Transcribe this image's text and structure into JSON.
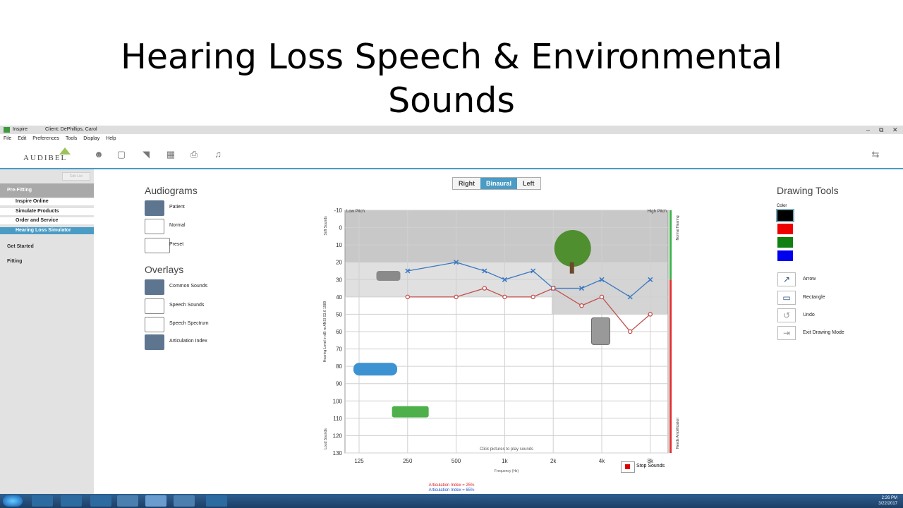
{
  "slide": {
    "title_line1": "Hearing Loss Speech & Environmental",
    "title_line2": "Sounds"
  },
  "window": {
    "app_name": "Inspire",
    "client": "Client: DePhillips, Carol",
    "controls": [
      "–",
      "⧉",
      "✕"
    ]
  },
  "menu": [
    "File",
    "Edit",
    "Preferences",
    "Tools",
    "Display",
    "Help"
  ],
  "toolbar": {
    "logo": "AUDIBEL",
    "icons": [
      "person-icon",
      "monitor-icon",
      "folder-open-icon",
      "calendar-icon",
      "printer-icon",
      "music-note-icon"
    ],
    "right_icon": "switch-device-icon"
  },
  "sidebar": {
    "edit_label": "Edit List",
    "sections": [
      {
        "label": "Pre-Fitting",
        "items": [
          "Inspire Online",
          "Simulate Products",
          "Order and Service",
          "Hearing Loss Simulator"
        ],
        "selected": "Hearing Loss Simulator"
      },
      {
        "label": "Get Started"
      },
      {
        "label": "Fitting"
      }
    ]
  },
  "audiograms": {
    "title": "Audiograms",
    "items": [
      "Patient",
      "Normal",
      "Preset"
    ]
  },
  "overlays": {
    "title": "Overlays",
    "items": [
      "Common Sounds",
      "Speech Sounds",
      "Speech Spectrum",
      "Articulation Index"
    ]
  },
  "ear_selector": {
    "options": [
      "Right",
      "Binaural",
      "Left"
    ],
    "selected": "Binaural"
  },
  "chart_data": {
    "type": "line",
    "top_left_label": "Low Pitch",
    "top_right_label": "High Pitch",
    "ylabel": "Hearing Level in dB re ANSI S3.6 1989",
    "ylabel_top": "Soft Sounds",
    "ylabel_bottom": "Loud Sounds",
    "right_label_top": "Normal Hearing",
    "right_label_bottom": "Needs Amplification",
    "xlabel": "Frequency (Hz)",
    "x_ticks": [
      "125",
      "250",
      "500",
      "1k",
      "2k",
      "4k",
      "8k"
    ],
    "y_ticks": [
      "-10",
      "0",
      "10",
      "20",
      "30",
      "40",
      "50",
      "60",
      "70",
      "80",
      "90",
      "100",
      "110",
      "120",
      "130"
    ],
    "ylim": [
      -10,
      130
    ],
    "hint": "Click pictures to play sounds",
    "series": [
      {
        "marker": "x",
        "color": "#3a78c2",
        "x": [
          250,
          500,
          750,
          1000,
          1500,
          2000,
          3000,
          4000,
          6000,
          8000
        ],
        "values": [
          25,
          20,
          25,
          30,
          25,
          35,
          35,
          30,
          40,
          30
        ]
      },
      {
        "marker": "o",
        "color": "#c0504d",
        "x": [
          250,
          500,
          750,
          1000,
          1500,
          2000,
          3000,
          4000,
          6000,
          8000
        ],
        "values": [
          40,
          40,
          35,
          40,
          40,
          35,
          45,
          40,
          60,
          50
        ]
      }
    ],
    "sound_icons": [
      "faucet-icon",
      "tree-icon",
      "phone-icon",
      "car-icon",
      "lawnmower-icon"
    ]
  },
  "drawing_tools": {
    "title": "Drawing Tools",
    "color_label": "Color",
    "colors": [
      "#000000",
      "#ee0000",
      "#108010",
      "#0000ee"
    ],
    "tools": [
      "Arrow",
      "Rectangle",
      "Undo",
      "Exit Drawing Mode"
    ]
  },
  "stop_sounds": "Stop Sounds",
  "articulation": {
    "line1": "Articulation Index = 25%",
    "line2": "Articulation Index = 65%"
  },
  "taskbar": {
    "time": "2:26 PM",
    "date": "3/22/2017"
  }
}
